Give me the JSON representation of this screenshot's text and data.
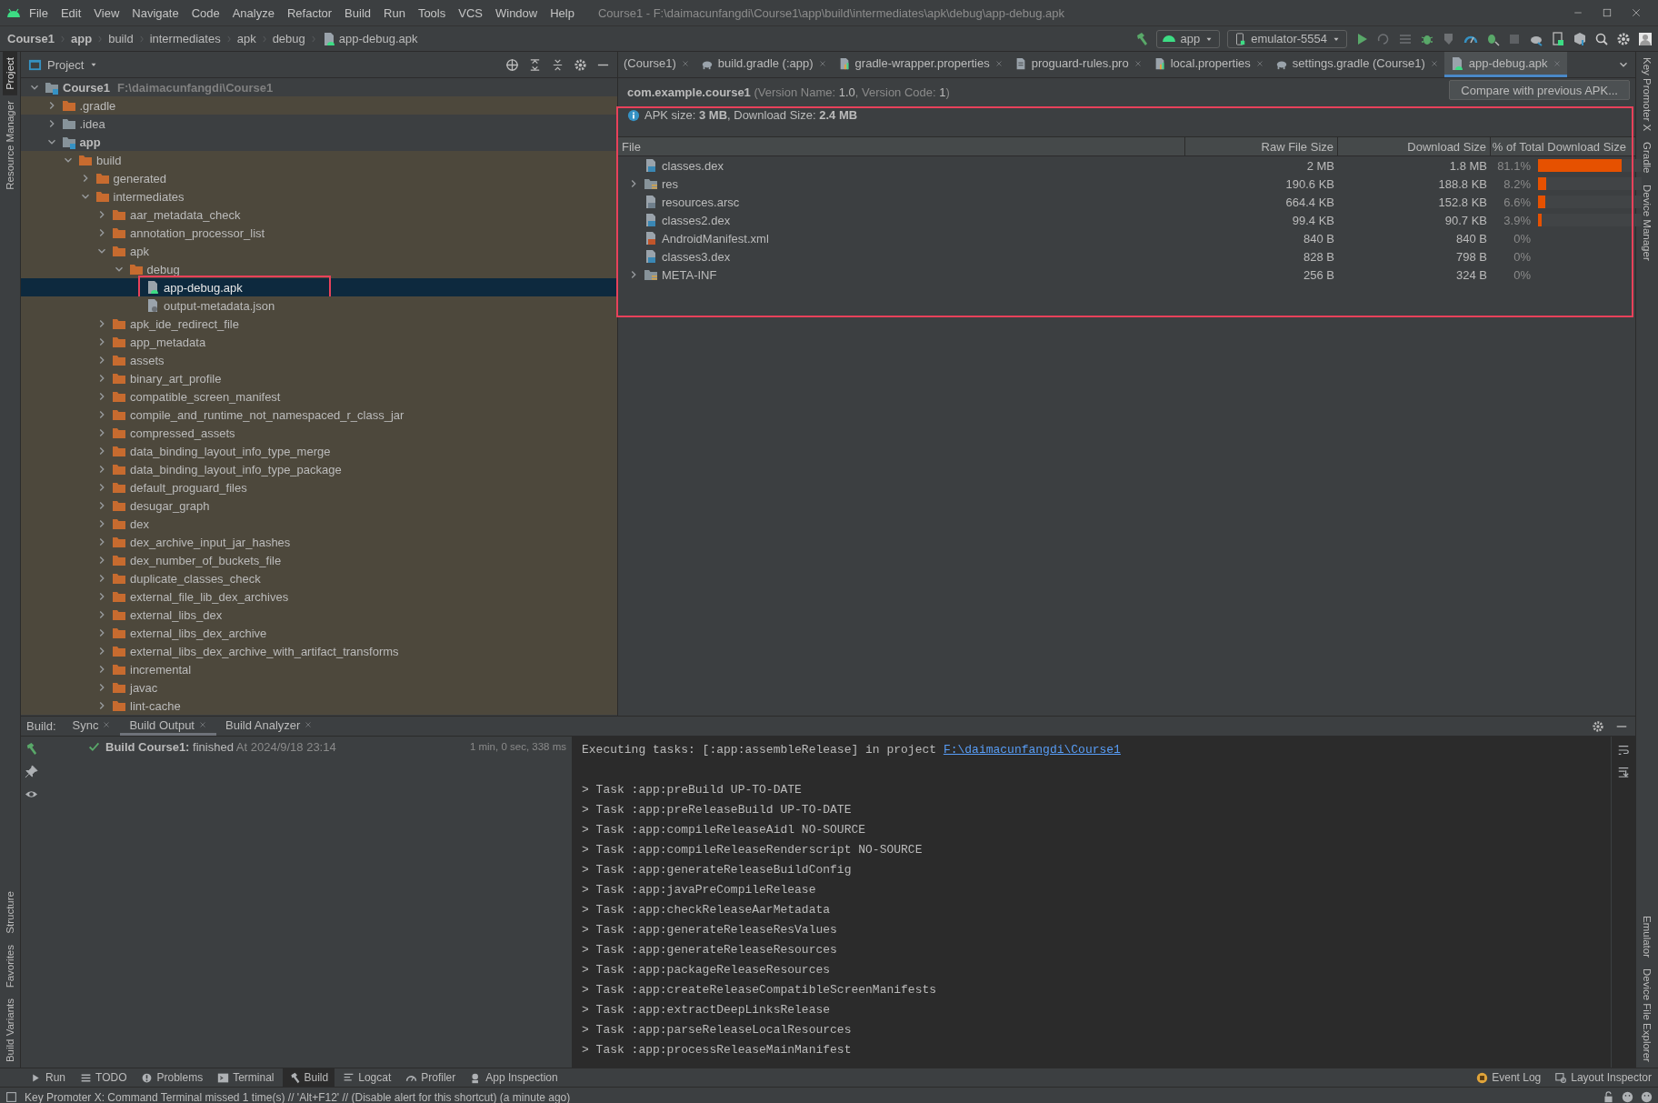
{
  "window": {
    "menu": [
      "File",
      "Edit",
      "View",
      "Navigate",
      "Code",
      "Analyze",
      "Refactor",
      "Build",
      "Run",
      "Tools",
      "VCS",
      "Window",
      "Help"
    ],
    "title": "Course1 - F:\\daimacunfangdi\\Course1\\app\\build\\intermediates\\apk\\debug\\app-debug.apk"
  },
  "breadcrumbs": [
    {
      "label": "Course1",
      "bold": true
    },
    {
      "label": "app",
      "bold": true
    },
    {
      "label": "build",
      "bold": false
    },
    {
      "label": "intermediates",
      "bold": false
    },
    {
      "label": "apk",
      "bold": false
    },
    {
      "label": "debug",
      "bold": false
    },
    {
      "label": "app-debug.apk",
      "bold": false
    }
  ],
  "run_configs": [
    {
      "label": "app",
      "kind": "module"
    },
    {
      "label": "emulator-5554",
      "kind": "device"
    }
  ],
  "left_stripe": [
    {
      "label": "Project",
      "selected": true
    },
    {
      "label": "Resource Manager",
      "selected": false
    },
    {
      "label": "Structure",
      "selected": false
    },
    {
      "label": "Favorites",
      "selected": false
    },
    {
      "label": "Build Variants",
      "selected": false
    }
  ],
  "right_stripe": [
    {
      "label": "Key Promoter X"
    },
    {
      "label": "Gradle"
    },
    {
      "label": "Device Manager"
    },
    {
      "label": "Emulator"
    },
    {
      "label": "Device File Explorer"
    }
  ],
  "project": {
    "title": "Project",
    "tree": [
      {
        "name": "Course1",
        "kind": "module",
        "path": "F:\\daimacunfangdi\\Course1",
        "expanded": true,
        "excluded": false,
        "selected": false,
        "children": [
          {
            "name": ".gradle",
            "kind": "folder",
            "expanded": false,
            "excluded": true,
            "selected": false
          },
          {
            "name": ".idea",
            "kind": "folder",
            "expanded": false,
            "excluded": false,
            "selected": false
          },
          {
            "name": "app",
            "kind": "module",
            "expanded": true,
            "excluded": false,
            "selected": false,
            "children": [
              {
                "name": "build",
                "kind": "folder",
                "expanded": true,
                "excluded": true,
                "selected": false,
                "children": [
                  {
                    "name": "generated",
                    "kind": "folder",
                    "expanded": false,
                    "excluded": true,
                    "selected": false
                  },
                  {
                    "name": "intermediates",
                    "kind": "folder",
                    "expanded": true,
                    "excluded": true,
                    "selected": false,
                    "children": [
                      {
                        "name": "aar_metadata_check",
                        "kind": "folder",
                        "expanded": false,
                        "excluded": true,
                        "selected": false
                      },
                      {
                        "name": "annotation_processor_list",
                        "kind": "folder",
                        "expanded": false,
                        "excluded": true,
                        "selected": false
                      },
                      {
                        "name": "apk",
                        "kind": "folder",
                        "expanded": true,
                        "excluded": true,
                        "selected": false,
                        "children": [
                          {
                            "name": "debug",
                            "kind": "folder",
                            "expanded": true,
                            "excluded": true,
                            "selected": false,
                            "children": [
                              {
                                "name": "app-debug.apk",
                                "kind": "apk",
                                "excluded": true,
                                "selected": true,
                                "highlighted": true
                              },
                              {
                                "name": "output-metadata.json",
                                "kind": "json",
                                "excluded": true,
                                "selected": false
                              }
                            ]
                          }
                        ]
                      },
                      {
                        "name": "apk_ide_redirect_file",
                        "kind": "folder",
                        "expanded": false,
                        "excluded": true,
                        "selected": false
                      },
                      {
                        "name": "app_metadata",
                        "kind": "folder",
                        "expanded": false,
                        "excluded": true,
                        "selected": false
                      },
                      {
                        "name": "assets",
                        "kind": "folder",
                        "expanded": false,
                        "excluded": true,
                        "selected": false
                      },
                      {
                        "name": "binary_art_profile",
                        "kind": "folder",
                        "expanded": false,
                        "excluded": true,
                        "selected": false
                      },
                      {
                        "name": "compatible_screen_manifest",
                        "kind": "folder",
                        "expanded": false,
                        "excluded": true,
                        "selected": false
                      },
                      {
                        "name": "compile_and_runtime_not_namespaced_r_class_jar",
                        "kind": "folder",
                        "expanded": false,
                        "excluded": true,
                        "selected": false
                      },
                      {
                        "name": "compressed_assets",
                        "kind": "folder",
                        "expanded": false,
                        "excluded": true,
                        "selected": false
                      },
                      {
                        "name": "data_binding_layout_info_type_merge",
                        "kind": "folder",
                        "expanded": false,
                        "excluded": true,
                        "selected": false
                      },
                      {
                        "name": "data_binding_layout_info_type_package",
                        "kind": "folder",
                        "expanded": false,
                        "excluded": true,
                        "selected": false
                      },
                      {
                        "name": "default_proguard_files",
                        "kind": "folder",
                        "expanded": false,
                        "excluded": true,
                        "selected": false
                      },
                      {
                        "name": "desugar_graph",
                        "kind": "folder",
                        "expanded": false,
                        "excluded": true,
                        "selected": false
                      },
                      {
                        "name": "dex",
                        "kind": "folder",
                        "expanded": false,
                        "excluded": true,
                        "selected": false
                      },
                      {
                        "name": "dex_archive_input_jar_hashes",
                        "kind": "folder",
                        "expanded": false,
                        "excluded": true,
                        "selected": false
                      },
                      {
                        "name": "dex_number_of_buckets_file",
                        "kind": "folder",
                        "expanded": false,
                        "excluded": true,
                        "selected": false
                      },
                      {
                        "name": "duplicate_classes_check",
                        "kind": "folder",
                        "expanded": false,
                        "excluded": true,
                        "selected": false
                      },
                      {
                        "name": "external_file_lib_dex_archives",
                        "kind": "folder",
                        "expanded": false,
                        "excluded": true,
                        "selected": false
                      },
                      {
                        "name": "external_libs_dex",
                        "kind": "folder",
                        "expanded": false,
                        "excluded": true,
                        "selected": false
                      },
                      {
                        "name": "external_libs_dex_archive",
                        "kind": "folder",
                        "expanded": false,
                        "excluded": true,
                        "selected": false
                      },
                      {
                        "name": "external_libs_dex_archive_with_artifact_transforms",
                        "kind": "folder",
                        "expanded": false,
                        "excluded": true,
                        "selected": false
                      },
                      {
                        "name": "incremental",
                        "kind": "folder",
                        "expanded": false,
                        "excluded": true,
                        "selected": false
                      },
                      {
                        "name": "javac",
                        "kind": "folder",
                        "expanded": false,
                        "excluded": true,
                        "selected": false
                      },
                      {
                        "name": "lint-cache",
                        "kind": "folder",
                        "expanded": false,
                        "excluded": true,
                        "selected": false
                      }
                    ]
                  }
                ]
              }
            ]
          }
        ]
      }
    ]
  },
  "editor_tabs": [
    {
      "label": "(Course1)",
      "selected": false
    },
    {
      "label": "build.gradle (:app)",
      "kind": "gradle",
      "selected": false
    },
    {
      "label": "gradle-wrapper.properties",
      "kind": "properties",
      "selected": false
    },
    {
      "label": "proguard-rules.pro",
      "kind": "text",
      "selected": false
    },
    {
      "label": "local.properties",
      "kind": "properties",
      "selected": false
    },
    {
      "label": "settings.gradle (Course1)",
      "kind": "gradle",
      "selected": false
    },
    {
      "label": "app-debug.apk",
      "kind": "apk",
      "selected": true
    }
  ],
  "apk": {
    "package": "com.example.course1",
    "version": "(Version Name: **1.0**, Version Code: **1**)",
    "summary": "APK size: **3 MB**, Download Size: **2.4 MB**",
    "compare_button": "Compare with previous APK...",
    "highlighted": true,
    "columns": [
      "File",
      "Raw File Size",
      "Download Size",
      "% of Total Download Size"
    ],
    "rows": [
      {
        "name": "classes.dex",
        "kind": "dex",
        "raw": "2 MB",
        "download": "1.8 MB",
        "percent": "81.1%",
        "level": 0.811
      },
      {
        "name": "res",
        "kind": "folder",
        "expanded": false,
        "raw": "190.6 KB",
        "download": "188.8 KB",
        "percent": "8.2%",
        "level": 0.082
      },
      {
        "name": "resources.arsc",
        "kind": "arsc",
        "raw": "664.4 KB",
        "download": "152.8 KB",
        "percent": "6.6%",
        "level": 0.066
      },
      {
        "name": "classes2.dex",
        "kind": "dex",
        "raw": "99.4 KB",
        "download": "90.7 KB",
        "percent": "3.9%",
        "level": 0.039
      },
      {
        "name": "AndroidManifest.xml",
        "kind": "xml",
        "raw": "840 B",
        "download": "840 B",
        "percent": "0%"
      },
      {
        "name": "classes3.dex",
        "kind": "dex",
        "raw": "828 B",
        "download": "798 B",
        "percent": "0%"
      },
      {
        "name": "META-INF",
        "kind": "folder",
        "expanded": false,
        "raw": "256 B",
        "download": "324 B",
        "percent": "0%"
      }
    ]
  },
  "build": {
    "label": "Build:",
    "tabs": [
      {
        "label": "Sync",
        "selected": false
      },
      {
        "label": "Build Output",
        "selected": true
      },
      {
        "label": "Build Analyzer",
        "selected": false
      }
    ],
    "result": {
      "title": "Build Course1:",
      "status": "finished",
      "time": "At 2024/9/18 23:14",
      "duration": "1 min, 0 sec, 338 ms",
      "success": true
    },
    "console": {
      "intro": "Executing tasks: [:app:assembleRelease] in project ",
      "link": "F:\\daimacunfangdi\\Course1",
      "lines": [
        "> Task :app:preBuild UP-TO-DATE",
        "> Task :app:preReleaseBuild UP-TO-DATE",
        "> Task :app:compileReleaseAidl NO-SOURCE",
        "> Task :app:compileReleaseRenderscript NO-SOURCE",
        "> Task :app:generateReleaseBuildConfig",
        "> Task :app:javaPreCompileRelease",
        "> Task :app:checkReleaseAarMetadata",
        "> Task :app:generateReleaseResValues",
        "> Task :app:generateReleaseResources",
        "> Task :app:packageReleaseResources",
        "> Task :app:createReleaseCompatibleScreenManifests",
        "> Task :app:extractDeepLinksRelease",
        "> Task :app:parseReleaseLocalResources",
        "> Task :app:processReleaseMainManifest"
      ]
    }
  },
  "tool_windows": [
    {
      "label": "Run",
      "kind": "run",
      "selected": false
    },
    {
      "label": "TODO",
      "kind": "todo",
      "selected": false
    },
    {
      "label": "Problems",
      "kind": "problems",
      "selected": false
    },
    {
      "label": "Terminal",
      "kind": "terminal",
      "selected": false
    },
    {
      "label": "Build",
      "kind": "build",
      "selected": true
    },
    {
      "label": "Logcat",
      "kind": "logcat",
      "selected": false
    },
    {
      "label": "Profiler",
      "kind": "profiler",
      "selected": false
    },
    {
      "label": "App Inspection",
      "kind": "inspection",
      "selected": false
    }
  ],
  "tool_windows_right": [
    {
      "label": "Event Log",
      "kind": "log"
    },
    {
      "label": "Layout Inspector",
      "kind": "inspector"
    }
  ],
  "status_bar": {
    "message": "Key Promoter X: Command Terminal missed 1 time(s) // 'Alt+F12' // (Disable alert for this shortcut) (a minute ago)"
  }
}
